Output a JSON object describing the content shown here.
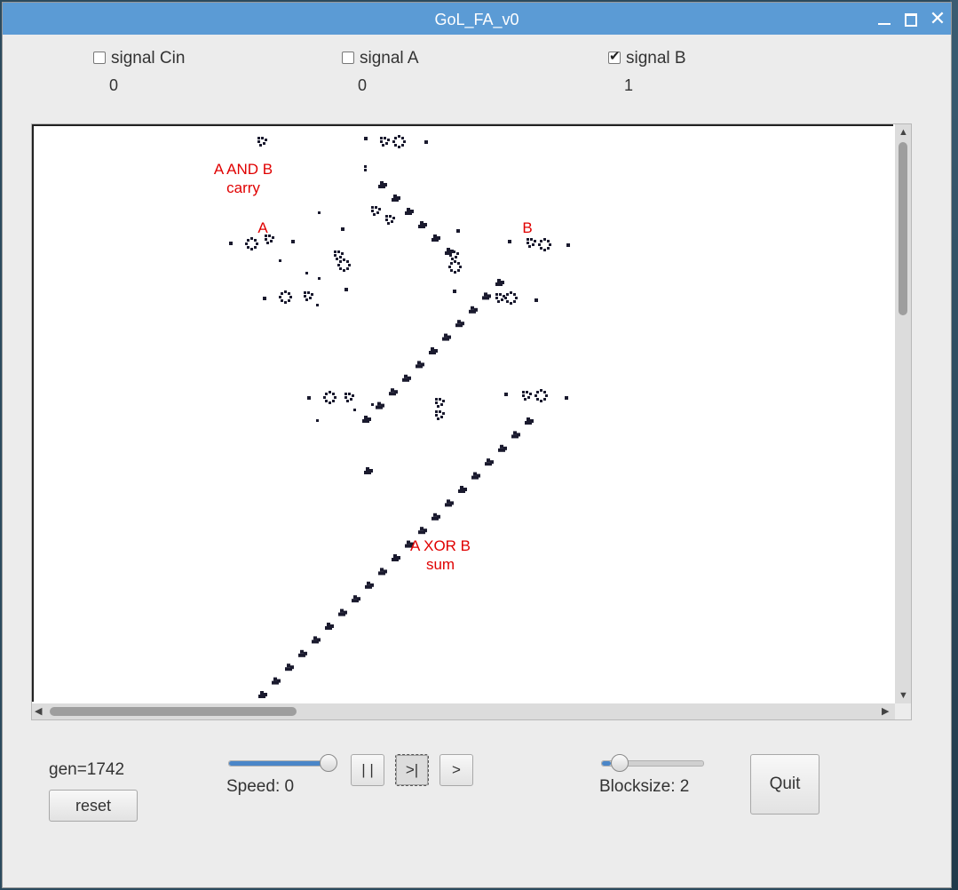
{
  "window": {
    "title": "GoL_FA_v0",
    "close_glyph": "✕"
  },
  "signals": [
    {
      "label": "signal Cin",
      "checked": false,
      "value": "0"
    },
    {
      "label": "signal A",
      "checked": false,
      "value": "0"
    },
    {
      "label": "signal B",
      "checked": true,
      "value": "1"
    }
  ],
  "canvas_labels": {
    "and_line1": "A AND B",
    "and_line2": "carry",
    "a": "A",
    "b": "B",
    "xor_line1": "A XOR B",
    "xor_line2": "sum"
  },
  "controls": {
    "gen": "gen=1742",
    "reset": "reset",
    "speed_label": "Speed: 0",
    "speed_level": 1.0,
    "pause": "| |",
    "step": ">|",
    "play": ">",
    "blocksize_label": "Blocksize: 2",
    "blocksize_level": 0.0,
    "quit": "Quit"
  },
  "scroll": {
    "vertical_position": 0.0,
    "horizontal_position": 0.0
  },
  "colors": {
    "title_bar": "#5b9bd5",
    "label_red": "#e00000",
    "cell": "#1a1a2e",
    "slider_fill": "#4a86c8"
  },
  "icons": [
    "minimize-icon",
    "maximize-icon",
    "close-icon",
    "scroll-up-arrow-icon",
    "scroll-down-arrow-icon",
    "scroll-left-arrow-icon",
    "scroll-right-arrow-icon"
  ]
}
